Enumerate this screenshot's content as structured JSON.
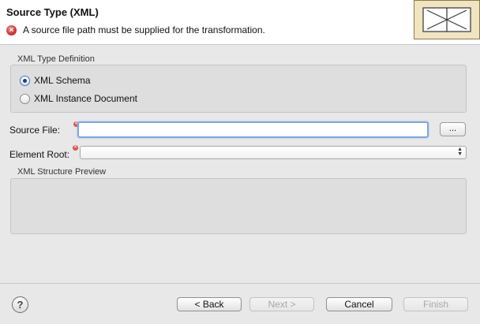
{
  "header": {
    "title": "Source Type (XML)",
    "error_message": "A source file path must be supplied for the transformation.",
    "error_icon": "error-icon",
    "wizard_graphic_icon": "wizard-banner-icon"
  },
  "type_definition": {
    "label": "XML Type Definition",
    "options": [
      {
        "label": "XML Schema",
        "selected": true
      },
      {
        "label": "XML Instance Document",
        "selected": false
      }
    ]
  },
  "source_file": {
    "label": "Source File:",
    "value": "",
    "browse_label": "..."
  },
  "element_root": {
    "label": "Element Root:",
    "value": ""
  },
  "preview": {
    "label": "XML Structure Preview"
  },
  "footer": {
    "help_label": "?",
    "back_label": "< Back",
    "next_label": "Next >",
    "cancel_label": "Cancel",
    "finish_label": "Finish"
  },
  "colors": {
    "error": "#c62828",
    "focus_border": "#7fa6e0",
    "banner_graphic_bg": "#f1e4c0"
  }
}
